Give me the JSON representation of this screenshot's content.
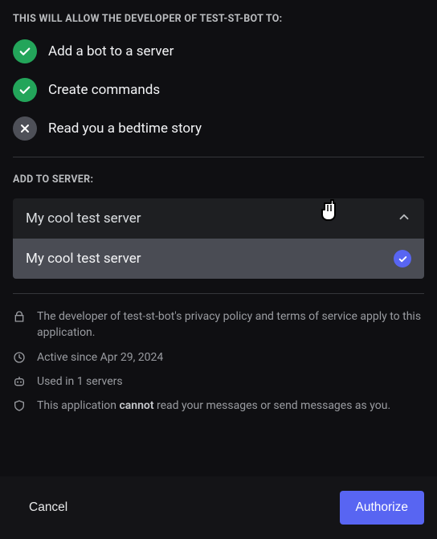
{
  "allow_title": "THIS WILL ALLOW THE DEVELOPER OF TEST-ST-BOT TO:",
  "permissions": [
    {
      "label": "Add a bot to a server",
      "granted": true
    },
    {
      "label": "Create commands",
      "granted": true
    },
    {
      "label": "Read you a bedtime story",
      "granted": false
    }
  ],
  "add_to_server_title": "ADD TO SERVER:",
  "dropdown": {
    "selected": "My cool test server",
    "options": [
      {
        "label": "My cool test server",
        "checked": true
      }
    ]
  },
  "info": {
    "privacy": "The developer of test-st-bot's privacy policy and terms of service apply to this application.",
    "active_since": "Active since Apr 29, 2024",
    "used_in": "Used in 1 servers",
    "read_prefix": "This application ",
    "read_emph": "cannot",
    "read_suffix": " read your messages or send messages as you."
  },
  "footer": {
    "cancel": "Cancel",
    "authorize": "Authorize"
  }
}
